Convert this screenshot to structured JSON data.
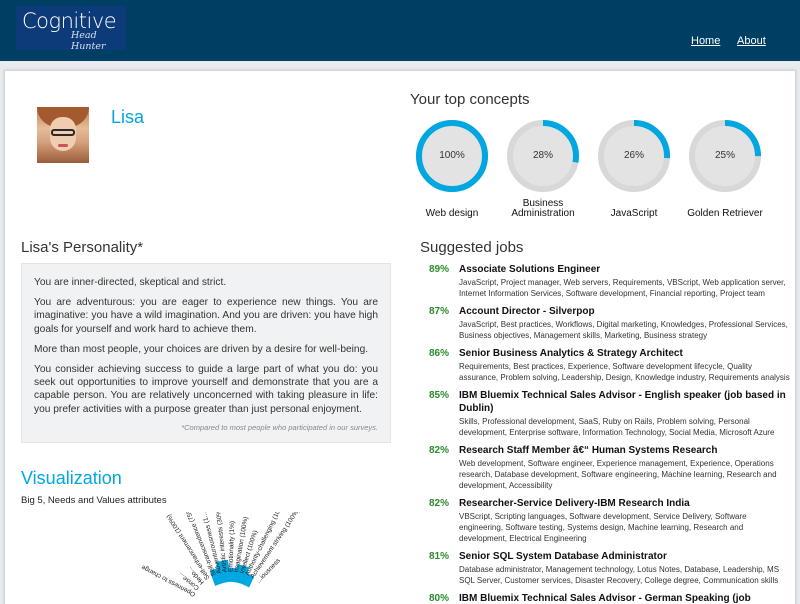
{
  "header": {
    "logo_main": "Cognitive",
    "logo_sub": "Head Hunter",
    "nav": [
      {
        "label": "Home"
      },
      {
        "label": "About"
      }
    ]
  },
  "profile": {
    "name": "Lisa"
  },
  "concepts": {
    "title": "Your top concepts",
    "accent_color": "#00a7e0",
    "ring_bg_color": "#d8d8d8",
    "items": [
      {
        "value_label": "100%",
        "fraction": 1.0,
        "label": "Web design"
      },
      {
        "value_label": "28%",
        "fraction": 0.28,
        "label": "Business Administration"
      },
      {
        "value_label": "26%",
        "fraction": 0.26,
        "label": "JavaScript"
      },
      {
        "value_label": "25%",
        "fraction": 0.25,
        "label": "Golden Retriever"
      }
    ]
  },
  "personality": {
    "title": "Lisa's Personality*",
    "paragraphs": [
      "You are inner-directed, skeptical and strict.",
      "You are adventurous: you are eager to experience new things. You are imaginative: you have a wild imagination. And you are driven: you have high goals for yourself and work hard to achieve them.",
      "More than most people, your choices are driven by a desire for well-being.",
      "You consider achieving success to guide a large part of what you do: you seek out opportunities to improve yourself and demonstrate that you are a capable person. You are relatively unconcerned with taking pleasure in life: you prefer activities with a purpose greater than just personal enjoyment."
    ],
    "note": "*Compared to most people who participated in our surveys."
  },
  "visualization": {
    "title": "Visualization",
    "subtitle": "Big 5, Needs and Values attributes",
    "labels": [
      "Openness to change",
      "Conse...",
      "Hedo...",
      "Self-enhancement (100%)",
      "Self-transcendence (75%)",
      "Adventurousness (1...",
      "Artistic interests (30%)",
      "Emotionality (1%)",
      "Imagination (100%)",
      "Intellect (100%)",
      "Authority-challenging (100%)",
      "Achievement striving (100%)",
      "...iousness"
    ]
  },
  "jobs": {
    "title": "Suggested jobs",
    "pct_color": "#2a8c2a",
    "items": [
      {
        "pct": "89%",
        "title": "Associate Solutions Engineer",
        "skills": "JavaScript, Project manager, Web servers, Requirements, VBScript, Web application server, Internet Information Services, Software development, Financial reporting, Project team"
      },
      {
        "pct": "87%",
        "title": "Account Director - Silverpop",
        "skills": "JavaScript, Best practices, Workflows, Digital marketing, Knowledges, Professional Services, Business objectives, Management skills, Marketing, Business strategy"
      },
      {
        "pct": "86%",
        "title": "Senior Business Analytics & Strategy Architect",
        "skills": "Requirements, Best practices, Experience, Software development lifecycle, Quality assurance, Problem solving, Leadership, Design, Knowledge industry, Requirements analysis"
      },
      {
        "pct": "85%",
        "title": "IBM Bluemix Technical Sales Advisor - English speaker (job based in Dublin)",
        "skills": "Skills, Professional development, SaaS, Ruby on Rails, Problem solving, Personal development, Enterprise software, Information Technology, Social Media, Microsoft Azure"
      },
      {
        "pct": "82%",
        "title": "Research Staff Member â€“ Human Systems Research",
        "skills": "Web development, Software engineer, Experience management, Experience, Operations research, Database development, Software engineering, Machine learning, Research and development, Accessibility"
      },
      {
        "pct": "82%",
        "title": "Researcher-Service Delivery-IBM Research India",
        "skills": "VBScript, Scripting languages, Software development, Service Delivery, Software engineering, Software testing, Systems design, Machine learning, Research and development, Electrical Engineering"
      },
      {
        "pct": "81%",
        "title": "Senior SQL System Database Administrator",
        "skills": "Database administrator, Management technology, Lotus Notes, Database, Leadership, MS SQL Server, Customer services, Disaster Recovery, College degree, Communication skills"
      },
      {
        "pct": "80%",
        "title": "IBM Bluemix Technical Sales Advisor - German Speaking (job",
        "skills": ""
      }
    ]
  }
}
